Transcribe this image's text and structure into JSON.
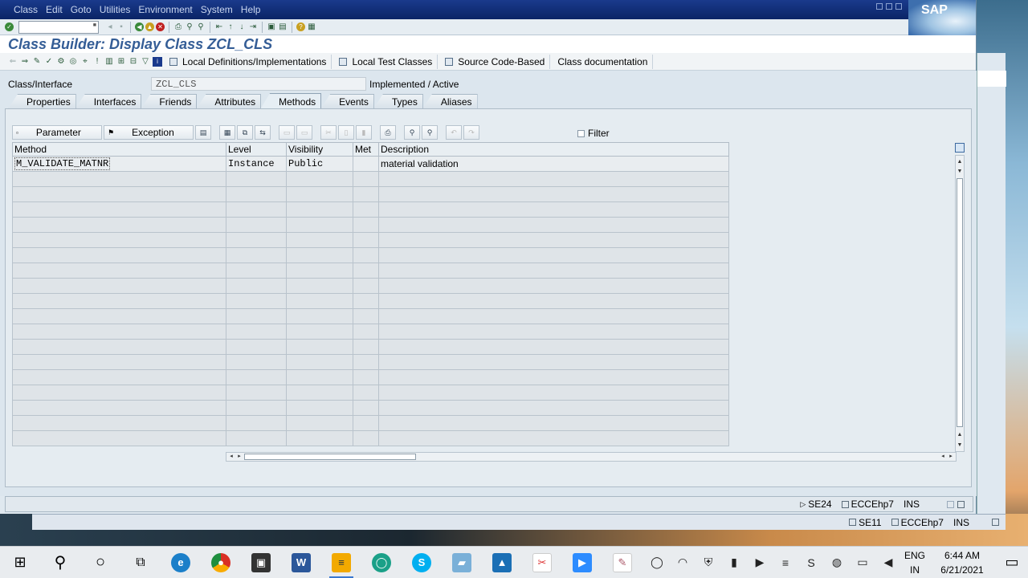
{
  "menu": {
    "items": [
      "Class",
      "Edit",
      "Goto",
      "Utilities",
      "Environment",
      "System",
      "Help"
    ],
    "logo": "SAP"
  },
  "title": "Class Builder: Display Class ZCL_CLS",
  "app_toolbar": {
    "local_defs": "Local Definitions/Implementations",
    "local_tests": "Local Test Classes",
    "source_code": "Source Code-Based",
    "class_doc": "Class documentation"
  },
  "header": {
    "label": "Class/Interface",
    "value": "ZCL_CLS",
    "status": "Implemented / Active"
  },
  "tabs": [
    {
      "label": "Properties",
      "active": false
    },
    {
      "label": "Interfaces",
      "active": false
    },
    {
      "label": "Friends",
      "active": false
    },
    {
      "label": "Attributes",
      "active": false
    },
    {
      "label": "Methods",
      "active": true
    },
    {
      "label": "Events",
      "active": false
    },
    {
      "label": "Types",
      "active": false
    },
    {
      "label": "Aliases",
      "active": false
    }
  ],
  "grid_toolbar": {
    "parameter": "Parameter",
    "exception": "Exception",
    "filter": "Filter"
  },
  "table": {
    "columns": [
      "Method",
      "Level",
      "Visibility",
      "Met",
      "Description"
    ],
    "rows": [
      {
        "method": "M_VALIDATE_MATNR",
        "level": "Instance",
        "visibility": "Public",
        "met": "",
        "description": "material validation"
      }
    ]
  },
  "status": {
    "tcode": "SE24",
    "system": "ECCEhp7",
    "mode": "INS"
  },
  "bg_status": {
    "tcode": "SE11",
    "system": "ECCEhp7",
    "mode": "INS"
  },
  "taskbar": {
    "lang1": "ENG",
    "lang2": "IN",
    "time": "6:44 AM",
    "date": "6/21/2021"
  }
}
